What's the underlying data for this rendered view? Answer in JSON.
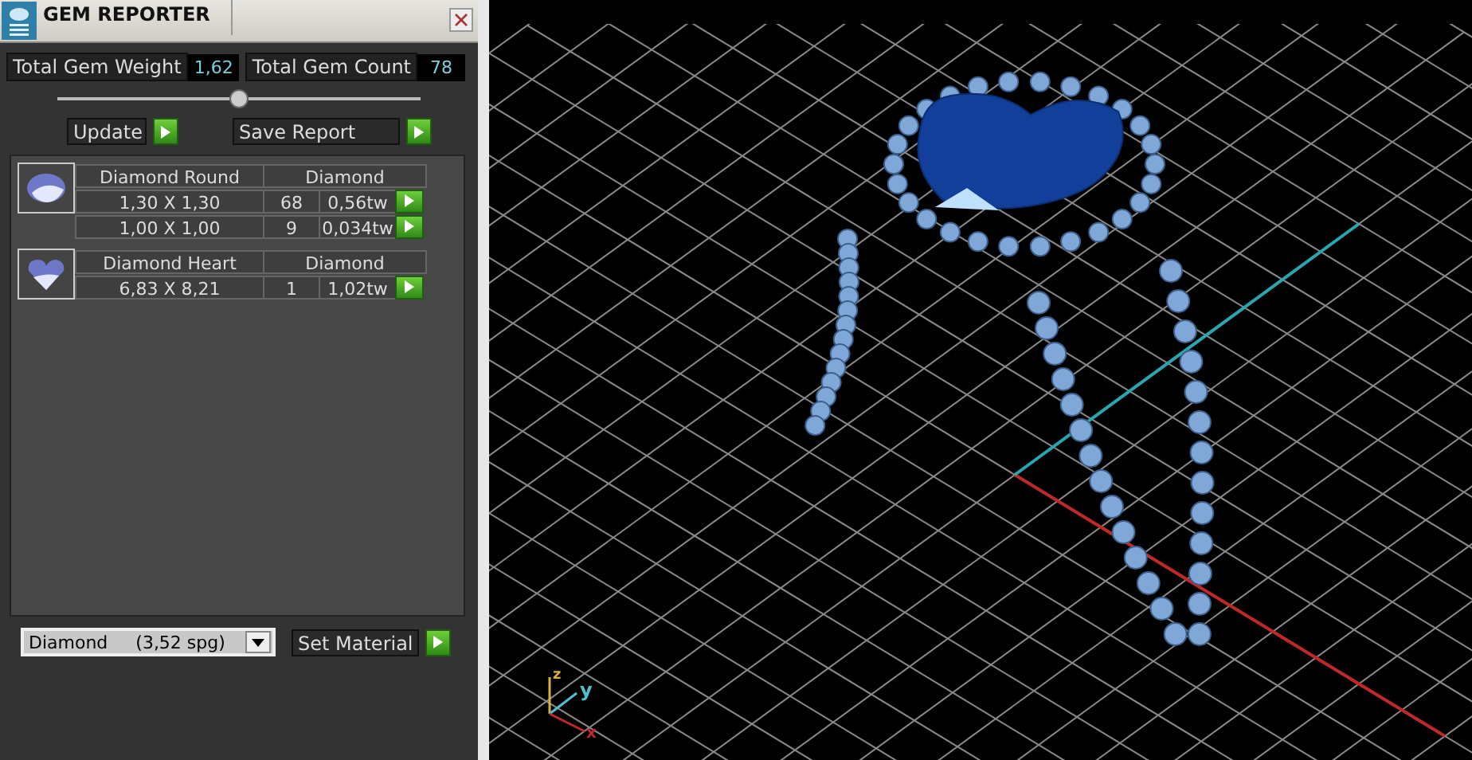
{
  "panel": {
    "title": "GEM REPORTER",
    "totals": [
      {
        "label": "Total Gem Weight",
        "value": "1,62"
      },
      {
        "label": "Total Gem Count",
        "value": "78"
      }
    ],
    "actions": [
      "Update",
      "Save Report"
    ],
    "gems": [
      {
        "kind": "round",
        "name": "Diamond Round",
        "material": "Diamond",
        "sizes": [
          {
            "size": "1,30 X 1,30",
            "count": "68",
            "weight": "0,56tw"
          },
          {
            "size": "1,00 X 1,00",
            "count": "9",
            "weight": "0,034tw"
          }
        ]
      },
      {
        "kind": "heart",
        "name": "Diamond Heart",
        "material": "Diamond",
        "sizes": [
          {
            "size": "6,83 X 8,21",
            "count": "1",
            "weight": "1,02tw"
          }
        ]
      }
    ],
    "material_select": {
      "value": "Diamond     (3,52 spg)"
    },
    "set_button": "Set Material"
  },
  "viewport": {
    "axes": [
      {
        "kind": "z",
        "label": "z"
      },
      {
        "kind": "y",
        "label": "y"
      },
      {
        "kind": "x",
        "label": "x"
      }
    ]
  }
}
